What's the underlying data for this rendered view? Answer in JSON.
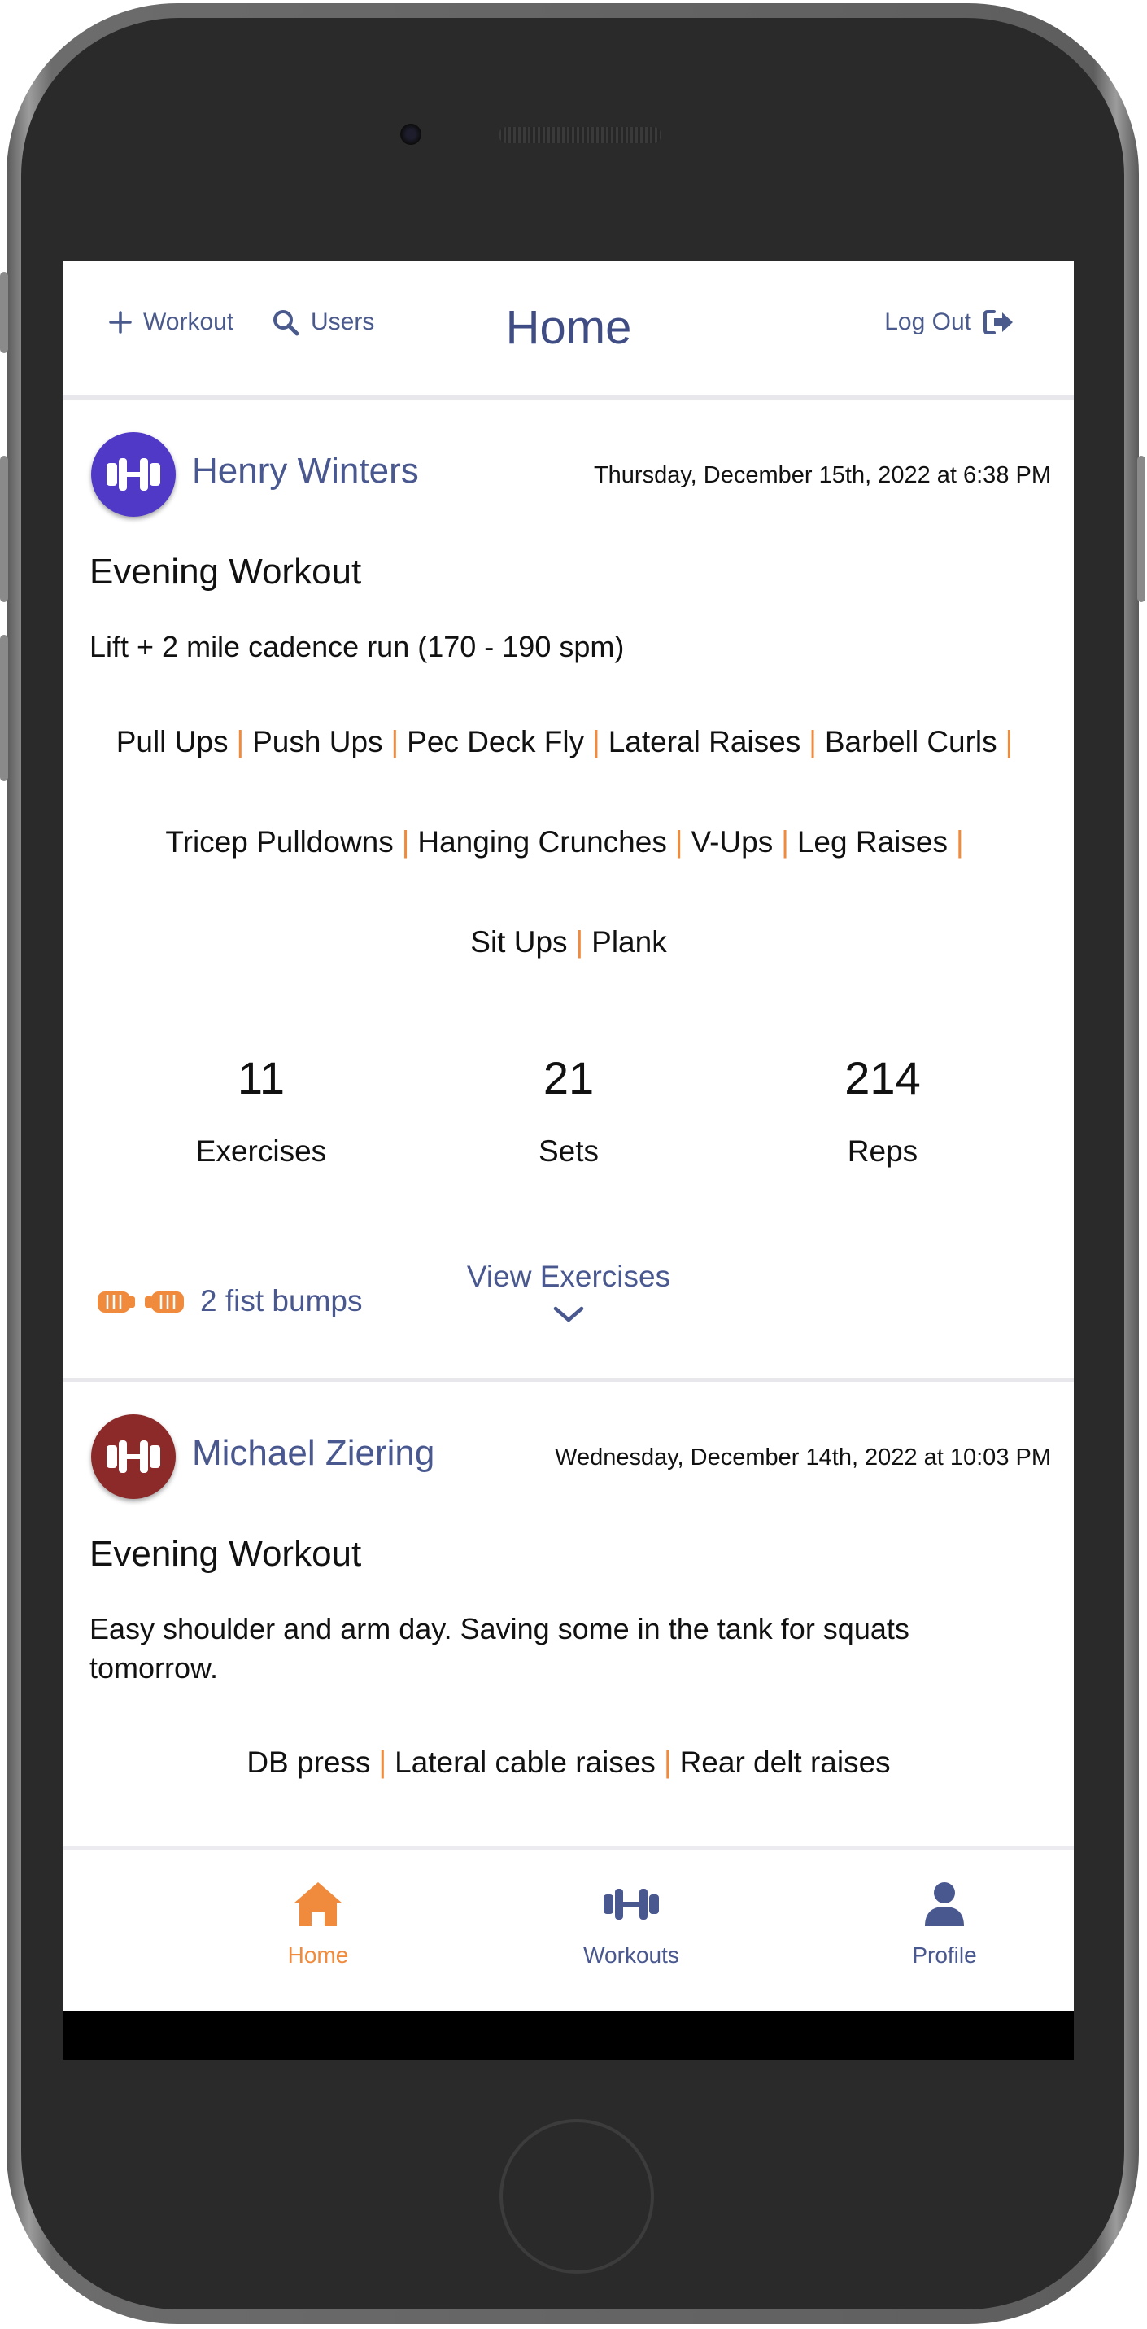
{
  "header": {
    "add_workout_label": "Workout",
    "users_label": "Users",
    "title": "Home",
    "logout_label": "Log Out"
  },
  "posts": [
    {
      "user": "Henry Winters",
      "avatar_color": "#4f39c6",
      "date": "Thursday, December 15th, 2022 at 6:38 PM",
      "title": "Evening Workout",
      "description": "Lift + 2 mile cadence run (170 - 190 spm)",
      "exercises": [
        "Pull Ups",
        "Push Ups",
        "Pec Deck Fly",
        "Lateral Raises",
        "Barbell Curls",
        "Tricep Pulldowns",
        "Hanging Crunches",
        "V-Ups",
        "Leg Raises",
        "Sit Ups",
        "Plank"
      ],
      "stats": {
        "exercises_value": "11",
        "exercises_label": "Exercises",
        "sets_value": "21",
        "sets_label": "Sets",
        "reps_value": "214",
        "reps_label": "Reps"
      },
      "fist_bumps": "2 fist bumps",
      "view_exercises": "View Exercises"
    },
    {
      "user": "Michael Ziering",
      "avatar_color": "#8c2a2a",
      "date": "Wednesday, December 14th, 2022 at 10:03 PM",
      "title": "Evening Workout",
      "description": "Easy shoulder and arm day. Saving some in the tank for squats tomorrow.",
      "exercises": [
        "DB press",
        "Lateral cable raises",
        "Rear delt raises"
      ]
    }
  ],
  "nav": {
    "home_label": "Home",
    "workouts_label": "Workouts",
    "profile_label": "Profile"
  },
  "colors": {
    "accent": "#f08a3c",
    "primary": "#4a5890"
  },
  "icons": [
    "plus-icon",
    "search-icon",
    "logout-icon",
    "dumbbell-icon",
    "fist-bump-icon",
    "chevron-down-icon",
    "home-icon",
    "user-icon"
  ]
}
